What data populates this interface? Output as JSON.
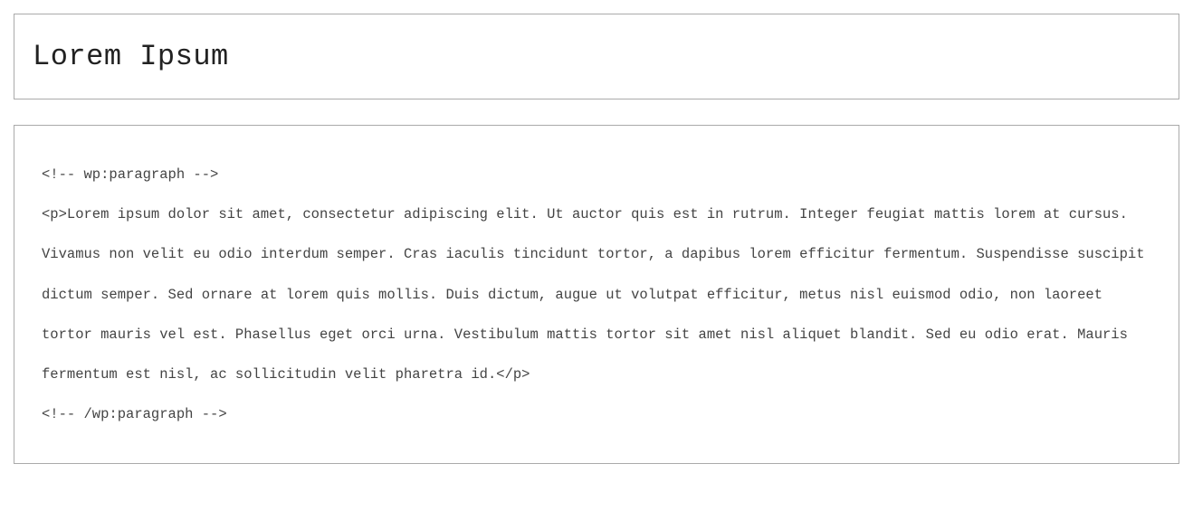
{
  "editor": {
    "title": "Lorem Ipsum",
    "code_content": "<!-- wp:paragraph -->\n<p>Lorem ipsum dolor sit amet, consectetur adipiscing elit. Ut auctor quis est in rutrum. Integer feugiat mattis lorem at cursus. Vivamus non velit eu odio interdum semper. Cras iaculis tincidunt tortor, a dapibus lorem efficitur fermentum. Suspendisse suscipit dictum semper. Sed ornare at lorem quis mollis. Duis dictum, augue ut volutpat efficitur, metus nisl euismod odio, non laoreet tortor mauris vel est. Phasellus eget orci urna. Vestibulum mattis tortor sit amet nisl aliquet blandit. Sed eu odio erat. Mauris fermentum est nisl, ac sollicitudin velit pharetra id.</p>\n<!-- /wp:paragraph -->"
  }
}
